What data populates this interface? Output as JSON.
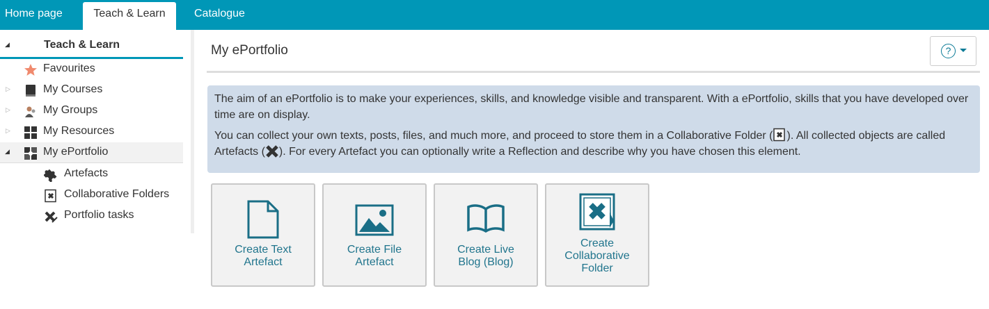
{
  "topnav": {
    "tabs": [
      {
        "label": "Home page"
      },
      {
        "label": "Teach & Learn"
      },
      {
        "label": "Catalogue"
      }
    ]
  },
  "sidebar": {
    "header": "Teach & Learn",
    "items": [
      {
        "label": "Favourites",
        "icon": "star-icon"
      },
      {
        "label": "My Courses",
        "icon": "book-icon"
      },
      {
        "label": "My Groups",
        "icon": "group-icon"
      },
      {
        "label": "My Resources",
        "icon": "grid-icon"
      },
      {
        "label": "My ePortfolio",
        "icon": "eportfolio-icon"
      }
    ],
    "subitems": [
      {
        "label": "Artefacts",
        "icon": "puzzle-icon"
      },
      {
        "label": "Collaborative Folders",
        "icon": "folder-puzzle-icon"
      },
      {
        "label": "Portfolio tasks",
        "icon": "puzzle-pen-icon"
      }
    ]
  },
  "main": {
    "title": "My ePortfolio",
    "help_icon": "question-circle-icon",
    "info": {
      "p1": "The aim of an ePortfolio is to make your experiences, skills, and knowledge visible and transparent. With a ePortfolio, skills that you have developed over time are on display.",
      "p2a": "You can collect your own texts, posts, files, and much more, and proceed to store them in a Collaborative Folder (",
      "p2b": "). All collected objects are called Artefacts (",
      "p2c": "). For every Artefact you can optionally write a Reflection and describe why you have chosen this element."
    },
    "cards": [
      {
        "l1": "Create Text",
        "l2": "Artefact",
        "icon": "document-icon"
      },
      {
        "l1": "Create File",
        "l2": "Artefact",
        "icon": "image-icon"
      },
      {
        "l1": "Create Live",
        "l2": "Blog (Blog)",
        "icon": "open-book-icon"
      },
      {
        "l1": "Create",
        "l2": "Collaborative",
        "l3": "Folder",
        "icon": "folder-puzzle-icon"
      }
    ]
  },
  "colors": {
    "accent": "#0097b7",
    "info_bg": "#cfdbe9",
    "card_text": "#21758d",
    "icon": "#1a6e86"
  }
}
